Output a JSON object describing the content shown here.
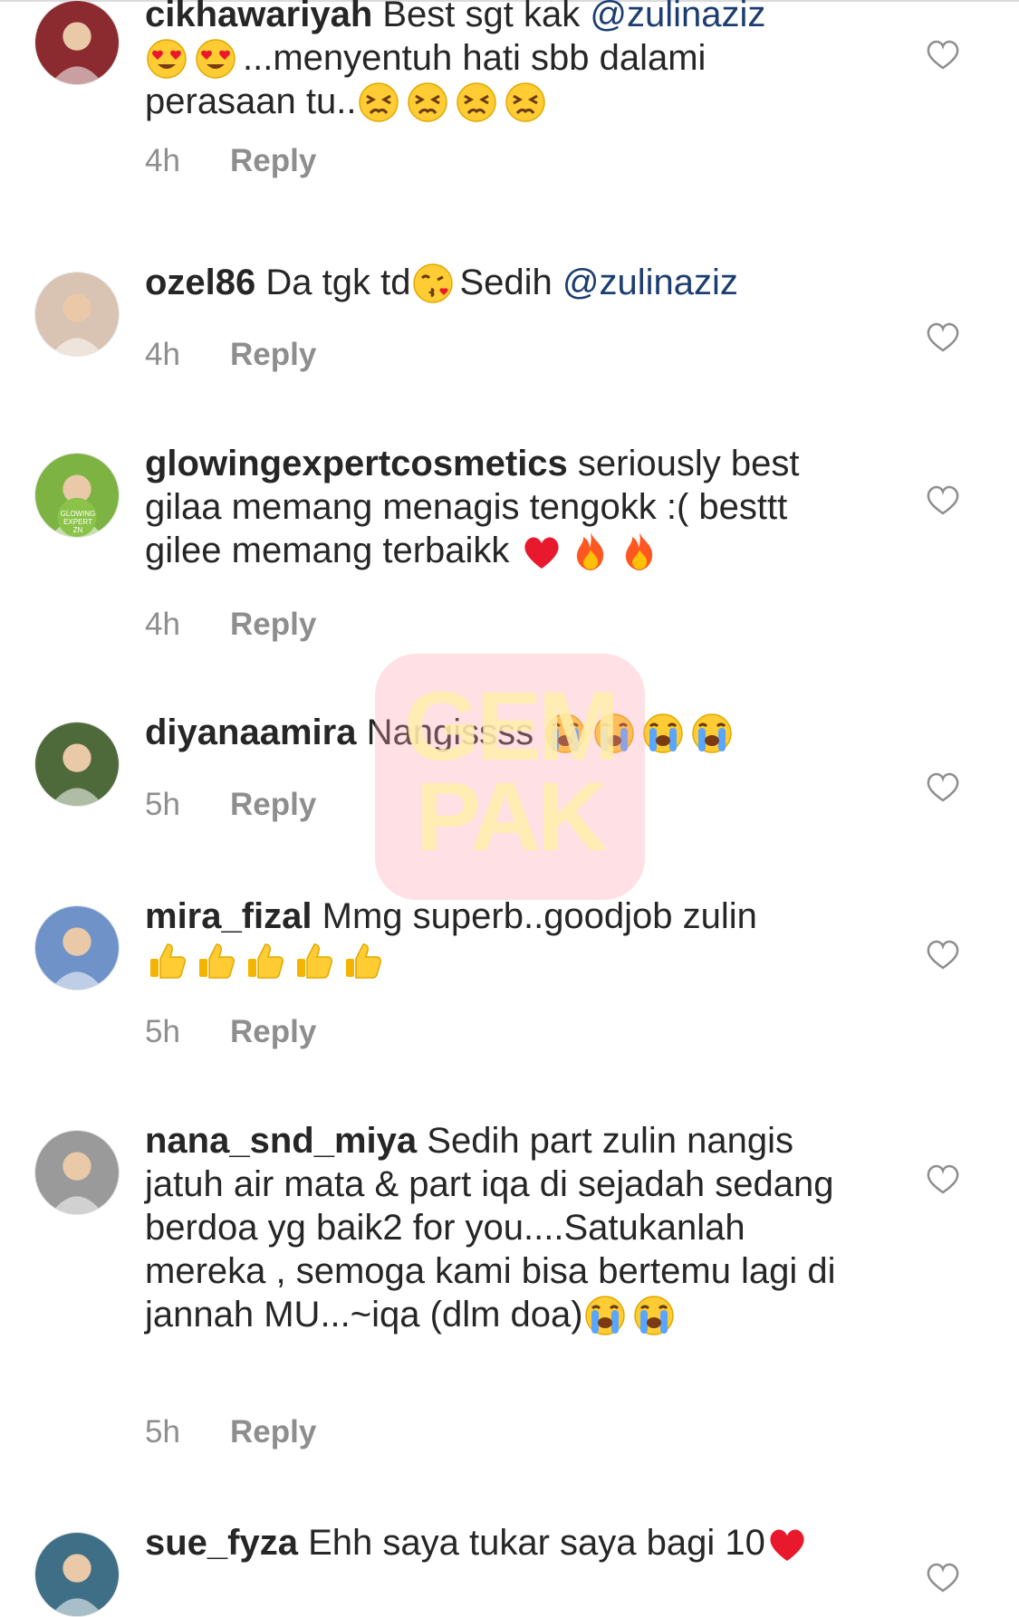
{
  "comments": [
    {
      "username": "cikhawariyah",
      "segments": [
        {
          "t": "Best sgt kak "
        },
        {
          "m": "@zulinaziz"
        },
        {
          "br": true
        },
        {
          "e": "heart-eyes"
        },
        {
          "e": "heart-eyes"
        },
        {
          "t": "...menyentuh hati sbb dalami"
        },
        {
          "br": true
        },
        {
          "t": "perasaan tu.."
        },
        {
          "e": "persevering"
        },
        {
          "e": "persevering"
        },
        {
          "e": "persevering"
        },
        {
          "e": "persevering"
        }
      ],
      "time": "4h",
      "reply_label": "Reply",
      "avatar_color": "#8b2b2f"
    },
    {
      "username": "ozel86",
      "segments": [
        {
          "t": "Da tgk td"
        },
        {
          "e": "kiss"
        },
        {
          "t": "Sedih "
        },
        {
          "m": "@zulinaziz"
        }
      ],
      "time": "4h",
      "reply_label": "Reply",
      "avatar_color": "#d9c3b2"
    },
    {
      "username": "glowingexpertcosmetics",
      "segments": [
        {
          "t": "seriously best gilaa memang menagis tengokk :( besttt gilee memang terbaikk "
        },
        {
          "e": "red-heart"
        },
        {
          "e": "fire"
        },
        {
          "e": "fire"
        }
      ],
      "time": "4h",
      "reply_label": "Reply",
      "avatar_color": "#7cb342",
      "avatar_text": "GLOWING EXPERT ZN"
    },
    {
      "username": "diyanaamira",
      "segments": [
        {
          "t": "Nangissss "
        },
        {
          "e": "crying"
        },
        {
          "e": "crying"
        },
        {
          "e": "crying"
        },
        {
          "e": "crying"
        }
      ],
      "time": "5h",
      "reply_label": "Reply",
      "avatar_color": "#4f6a3a"
    },
    {
      "username": "mira_fizal",
      "segments": [
        {
          "t": "Mmg superb..goodjob zulin"
        },
        {
          "br": true
        },
        {
          "e": "thumbs-up"
        },
        {
          "e": "thumbs-up"
        },
        {
          "e": "thumbs-up"
        },
        {
          "e": "thumbs-up"
        },
        {
          "e": "thumbs-up"
        }
      ],
      "time": "5h",
      "reply_label": "Reply",
      "avatar_color": "#6f93c8"
    },
    {
      "username": "nana_snd_miya",
      "segments": [
        {
          "t": "Sedih part zulin nangis jatuh air mata & part iqa di sejadah sedang berdoa yg baik2 for you....Satukanlah mereka , semoga kami bisa bertemu lagi di jannah MU...~iqa (dlm doa)"
        },
        {
          "e": "crying"
        },
        {
          "e": "crying"
        }
      ],
      "time": "5h",
      "reply_label": "Reply",
      "avatar_color": "#9a9a9a"
    },
    {
      "username": "sue_fyza",
      "segments": [
        {
          "t": "Ehh saya tukar saya bagi 10"
        },
        {
          "e": "red-heart"
        }
      ],
      "time": "",
      "reply_label": "",
      "avatar_color": "#3f6f86"
    }
  ],
  "watermark": {
    "line1": "GEM",
    "line2": "PAK"
  },
  "colors": {
    "mention": "#1b3d71",
    "meta": "#8e8e8e",
    "text": "#262626"
  },
  "icons": {
    "like": "heart-outline-icon"
  }
}
